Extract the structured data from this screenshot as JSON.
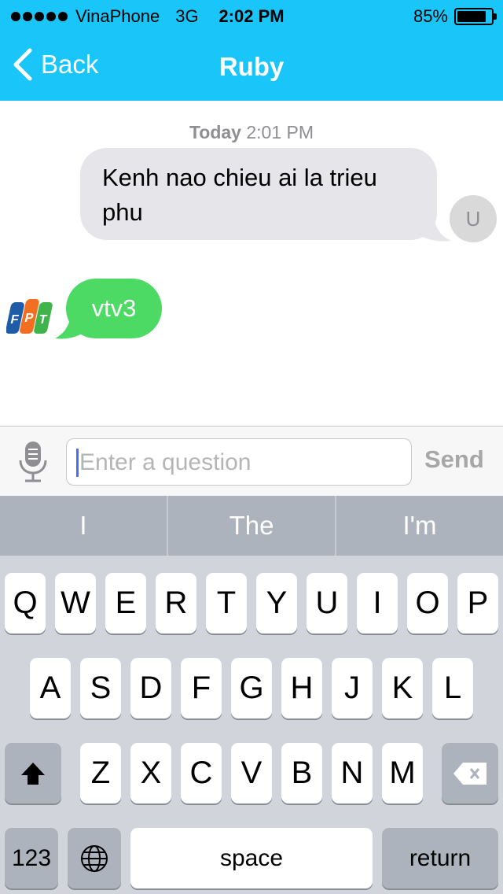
{
  "status_bar": {
    "carrier": "VinaPhone",
    "network": "3G",
    "time": "2:02 PM",
    "battery": "85%",
    "battery_level": 0.85
  },
  "nav": {
    "back_label": "Back",
    "title": "Ruby"
  },
  "chat": {
    "timestamp_day": "Today",
    "timestamp_time": "2:01 PM",
    "user_message": "Kenh nao chieu ai la trieu phu",
    "user_avatar": "U",
    "bot_logo": "FPT",
    "bot_message": "vtv3"
  },
  "input": {
    "placeholder": "Enter a question",
    "send_label": "Send"
  },
  "suggestions": [
    "I",
    "The",
    "I'm"
  ],
  "keyboard": {
    "row1": [
      "Q",
      "W",
      "E",
      "R",
      "T",
      "Y",
      "U",
      "I",
      "O",
      "P"
    ],
    "row2": [
      "A",
      "S",
      "D",
      "F",
      "G",
      "H",
      "J",
      "K",
      "L"
    ],
    "row3": [
      "Z",
      "X",
      "C",
      "V",
      "B",
      "N",
      "M"
    ],
    "numbers_label": "123",
    "space_label": "space",
    "return_label": "return"
  },
  "colors": {
    "header": "#1ac6f9",
    "user_bubble": "#e5e5ea",
    "bot_bubble": "#4cd964",
    "keyboard_bg": "#d1d5db"
  }
}
